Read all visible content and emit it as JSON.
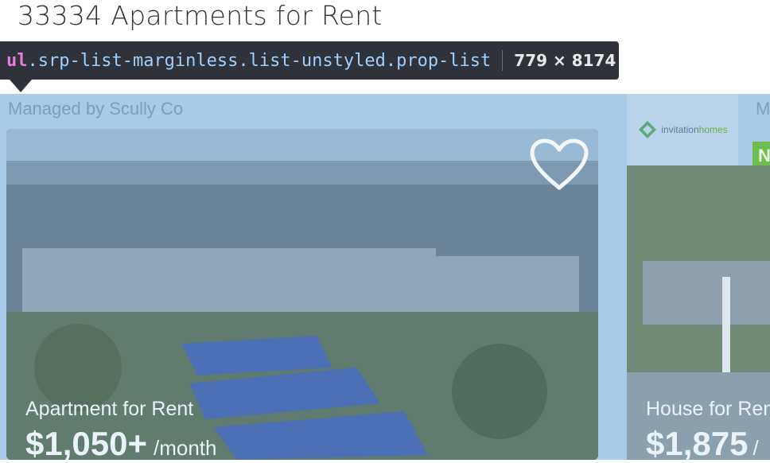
{
  "page": {
    "title": "33334 Apartments for Rent"
  },
  "inspector": {
    "tag": "ul",
    "classes": ".srp-list-marginless.list-unstyled.prop-list",
    "dimensions": "779 × 8174"
  },
  "listings": [
    {
      "managed_by": "Managed by Scully Co",
      "type": "Apartment for Rent",
      "price": "$1,050+",
      "per": "/month",
      "favorite_icon": "heart-icon"
    },
    {
      "managed_by": "M",
      "logo": {
        "part1": "invitation",
        "part2": "homes"
      },
      "badge": "N",
      "type": "House for Ren",
      "price": "$1,875",
      "per": "/"
    }
  ],
  "colors": {
    "highlight": "#a9cbe8",
    "inspector_bg": "#2f3238",
    "badge": "#6cbf4f"
  }
}
